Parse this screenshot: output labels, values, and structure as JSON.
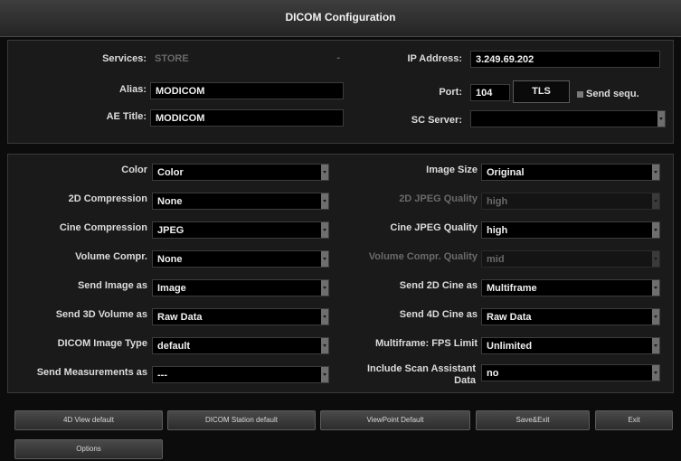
{
  "window": {
    "title": "DICOM Configuration"
  },
  "connection": {
    "services_label": "Services:",
    "services_value": "STORE",
    "alias_label": "Alias:",
    "alias_value": "MODICOM",
    "ae_title_label": "AE Title:",
    "ae_title_value": "MODICOM",
    "ip_label": "IP Address:",
    "ip_value": "3.249.69.202",
    "port_label": "Port:",
    "port_value": "104",
    "tls_label": "TLS",
    "send_sequ_label": "Send sequ.",
    "sc_server_label": "SC Server:",
    "sc_server_value": ""
  },
  "settings": {
    "color_label": "Color",
    "color_value": "Color",
    "compression_2d_label": "2D Compression",
    "compression_2d_value": "None",
    "cine_compression_label": "Cine Compression",
    "cine_compression_value": "JPEG",
    "volume_compr_label": "Volume Compr.",
    "volume_compr_value": "None",
    "send_image_as_label": "Send Image as",
    "send_image_as_value": "Image",
    "send_3d_volume_label": "Send 3D Volume as",
    "send_3d_volume_value": "Raw Data",
    "dicom_image_type_label": "DICOM Image Type",
    "dicom_image_type_value": "default",
    "send_measurements_label": "Send Measurements as",
    "send_measurements_value": "---",
    "image_size_label": "Image Size",
    "image_size_value": "Original",
    "jpeg_quality_2d_label": "2D JPEG Quality",
    "jpeg_quality_2d_value": "high",
    "cine_jpeg_quality_label": "Cine JPEG Quality",
    "cine_jpeg_quality_value": "high",
    "volume_compr_quality_label": "Volume Compr. Quality",
    "volume_compr_quality_value": "mid",
    "send_2d_cine_label": "Send 2D Cine as",
    "send_2d_cine_value": "Multiframe",
    "send_4d_cine_label": "Send 4D Cine as",
    "send_4d_cine_value": "Raw Data",
    "fps_limit_label": "Multiframe: FPS Limit",
    "fps_limit_value": "Unlimited",
    "scan_assistant_label": "Include Scan Assistant Data",
    "scan_assistant_value": "no"
  },
  "buttons": {
    "view_4d_default": "4D View default",
    "dicom_station_default": "DICOM Station default",
    "viewpoint_default": "ViewPoint Default",
    "save_exit": "Save&Exit",
    "exit": "Exit",
    "options": "Options"
  },
  "colors": {
    "background": "#0c0c0c",
    "panel": "#1a1a1a",
    "field": "#000000",
    "text": "#e6e6e6",
    "disabled_text": "#6a6a6a"
  },
  "icons": {
    "dropdown": "chevron-down-icon",
    "checkbox": "checkbox-icon"
  }
}
